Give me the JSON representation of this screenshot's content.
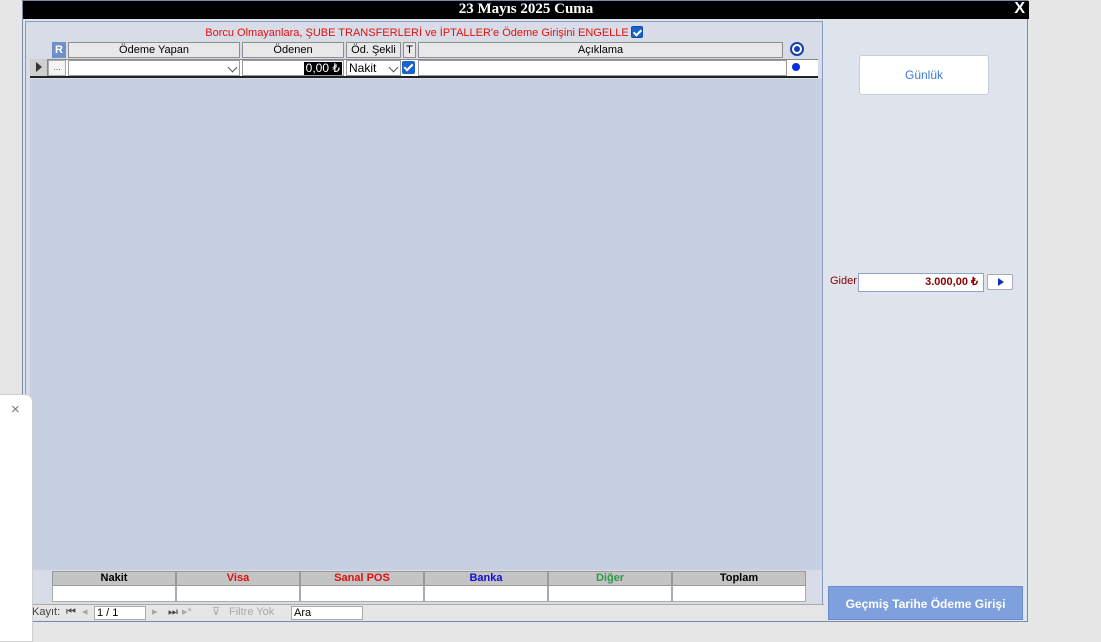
{
  "window": {
    "title": "23 Mayıs 2025 Cuma",
    "close_label": "X"
  },
  "notice": {
    "text": "Borcu Olmayanlara, ŞUBE TRANSFERLERİ ve İPTALLER'e Ödeme Girişini ENGELLE",
    "checked": true
  },
  "grid": {
    "r_button": "R",
    "columns": {
      "payer": "Ödeme Yapan",
      "paid": "Ödenen",
      "method": "Öd. Şekli",
      "t": "T",
      "desc": "Açıklama"
    },
    "new_row": {
      "dots": "...",
      "payer": "",
      "amount": "0,00 ₺",
      "method": "Nakit",
      "t_checked": true,
      "desc": ""
    }
  },
  "summary": {
    "columns": [
      {
        "label": "Nakit",
        "color": "#000000"
      },
      {
        "label": "Visa",
        "color": "#e01010"
      },
      {
        "label": "Sanal POS",
        "color": "#e01010"
      },
      {
        "label": "Banka",
        "color": "#1010d0"
      },
      {
        "label": "Diğer",
        "color": "#2e9a4a"
      },
      {
        "label": "Toplam",
        "color": "#000000"
      }
    ]
  },
  "navigator": {
    "record_label": "Kayıt:",
    "position": "1 / 1",
    "filter_label": "Filtre Yok",
    "search_value": "Ara"
  },
  "right": {
    "gunluk_label": "Günlük",
    "gider_label": "Gider",
    "gider_value": "3.000,00 ₺",
    "gecmis_label": "Geçmiş Tarihe Ödeme Girişi"
  },
  "side_panel": {
    "close_icon": "×"
  }
}
